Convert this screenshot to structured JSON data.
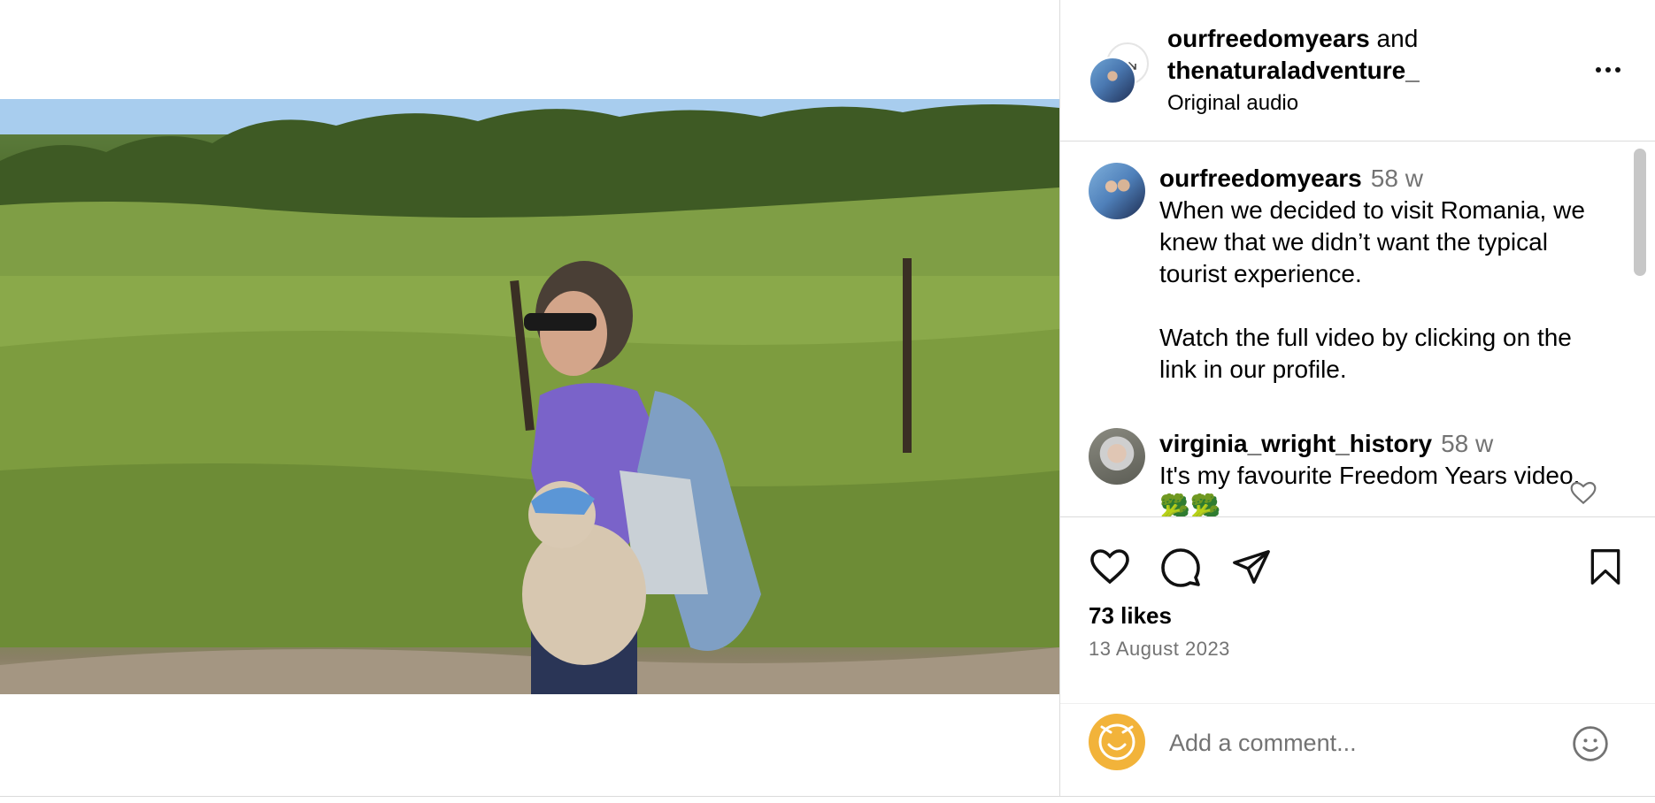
{
  "header": {
    "user1": "ourfreedomyears",
    "joiner": "and",
    "user2": "thenaturaladventure_",
    "audio": "Original audio"
  },
  "comments": [
    {
      "user": "ourfreedomyears",
      "time": "58 w",
      "text": "When we decided to visit Romania, we knew that we didn’t want the typical tourist experience.\n\nWatch the full video by clicking on the link in our profile."
    },
    {
      "user": "virginia_wright_history",
      "time": "58 w",
      "text": "It's my favourite Freedom Years video. 🥦🥦"
    }
  ],
  "stats": {
    "likes": "73 likes",
    "date": "13 August 2023"
  },
  "comment_box": {
    "placeholder": "Add a comment..."
  },
  "icons": {
    "more": "more-options-icon",
    "like": "heart-icon",
    "comment": "comment-icon",
    "share": "send-icon",
    "save": "bookmark-icon",
    "emoji": "emoji-icon",
    "mute": "speaker-muted-icon",
    "tagged": "person-icon"
  }
}
